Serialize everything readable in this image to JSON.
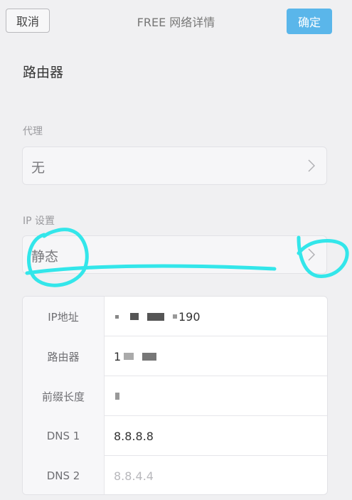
{
  "header": {
    "cancel_label": "取消",
    "title": "FREE 网络详情",
    "ok_label": "确定"
  },
  "router_section": {
    "title": "路由器"
  },
  "proxy": {
    "label": "代理",
    "value": "无"
  },
  "ip_settings": {
    "label": "IP 设置",
    "value": "静态"
  },
  "details": [
    {
      "key": "IP地址",
      "value": "190"
    },
    {
      "key": "路由器",
      "value": "1"
    },
    {
      "key": "前缀长度",
      "value": ""
    },
    {
      "key": "DNS 1",
      "value": "8.8.8.8"
    },
    {
      "key": "DNS 2",
      "value": "8.8.4.4"
    }
  ],
  "colors": {
    "accent": "#5ab6ea",
    "annotation": "#33e6ea"
  }
}
